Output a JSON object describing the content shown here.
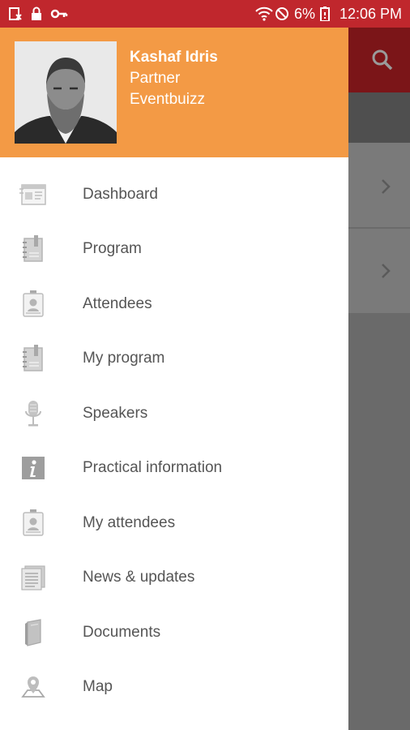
{
  "status_bar": {
    "battery": "6%",
    "time": "12:06 PM"
  },
  "profile": {
    "name": "Kashaf Idris",
    "role": "Partner",
    "company": "Eventbuizz"
  },
  "menu": [
    {
      "label": "Dashboard",
      "icon": "dashboard-icon"
    },
    {
      "label": "Program",
      "icon": "program-icon"
    },
    {
      "label": "Attendees",
      "icon": "attendee-badge-icon"
    },
    {
      "label": "My program",
      "icon": "my-program-icon"
    },
    {
      "label": "Speakers",
      "icon": "microphone-icon"
    },
    {
      "label": "Practical information",
      "icon": "info-icon"
    },
    {
      "label": "My attendees",
      "icon": "my-attendees-icon"
    },
    {
      "label": "News & updates",
      "icon": "news-icon"
    },
    {
      "label": "Documents",
      "icon": "document-icon"
    },
    {
      "label": "Map",
      "icon": "map-pin-icon"
    }
  ],
  "colors": {
    "status_bar": "#c0272d",
    "drawer_header": "#f39a45",
    "app_bar": "#7b1518"
  }
}
